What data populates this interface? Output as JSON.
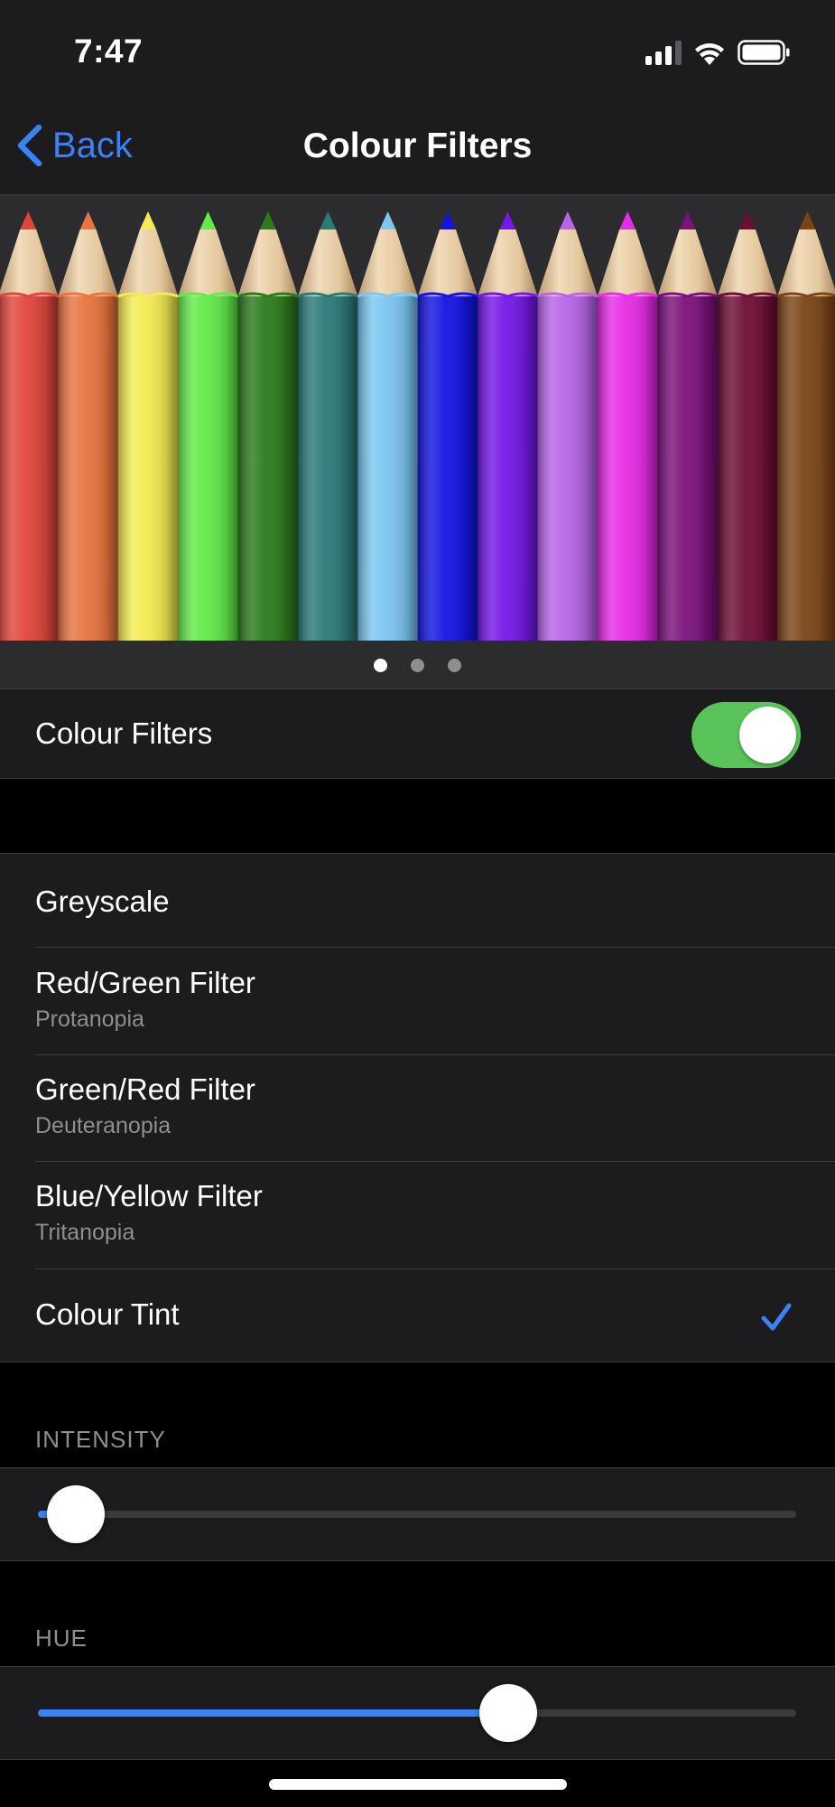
{
  "status_bar": {
    "time": "7:47"
  },
  "nav": {
    "back_label": "Back",
    "title": "Colour Filters"
  },
  "pager": {
    "pages": 3,
    "current": 0
  },
  "pencil_colors": [
    "#e0453c",
    "#e8743e",
    "#f4ec52",
    "#62ea48",
    "#2c7a1e",
    "#2a7a78",
    "#7cc6f2",
    "#1414e2",
    "#7418e6",
    "#b665e6",
    "#e62ce6",
    "#7a127a",
    "#6e0e36",
    "#7a4418"
  ],
  "toggle_row": {
    "label": "Colour Filters",
    "enabled": true
  },
  "filters": [
    {
      "title": "Greyscale",
      "subtitle": ""
    },
    {
      "title": "Red/Green Filter",
      "subtitle": "Protanopia"
    },
    {
      "title": "Green/Red Filter",
      "subtitle": "Deuteranopia"
    },
    {
      "title": "Blue/Yellow Filter",
      "subtitle": "Tritanopia"
    },
    {
      "title": "Colour Tint",
      "subtitle": "",
      "selected": true
    }
  ],
  "intensity": {
    "header": "INTENSITY",
    "value": 0.05
  },
  "hue": {
    "header": "HUE",
    "value": 0.62
  },
  "colors": {
    "accent": "#3b82f6",
    "toggle_on": "#5ac45a",
    "background": "#000000",
    "cell": "#1c1c1e"
  }
}
